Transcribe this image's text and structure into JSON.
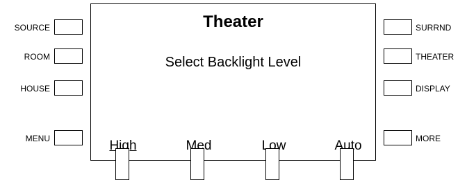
{
  "screen": {
    "title": "Theater",
    "message": "Select Backlight Level"
  },
  "left_buttons": [
    {
      "label": "SOURCE"
    },
    {
      "label": "ROOM"
    },
    {
      "label": "HOUSE"
    },
    {
      "label": "MENU"
    }
  ],
  "right_buttons": [
    {
      "label": "SURRND"
    },
    {
      "label": "THEATER"
    },
    {
      "label": "DISPLAY"
    },
    {
      "label": "MORE"
    }
  ],
  "softkeys": [
    {
      "label": "High",
      "selected": true
    },
    {
      "label": "Med",
      "selected": false
    },
    {
      "label": "Low",
      "selected": false
    },
    {
      "label": "Auto",
      "selected": false
    }
  ]
}
